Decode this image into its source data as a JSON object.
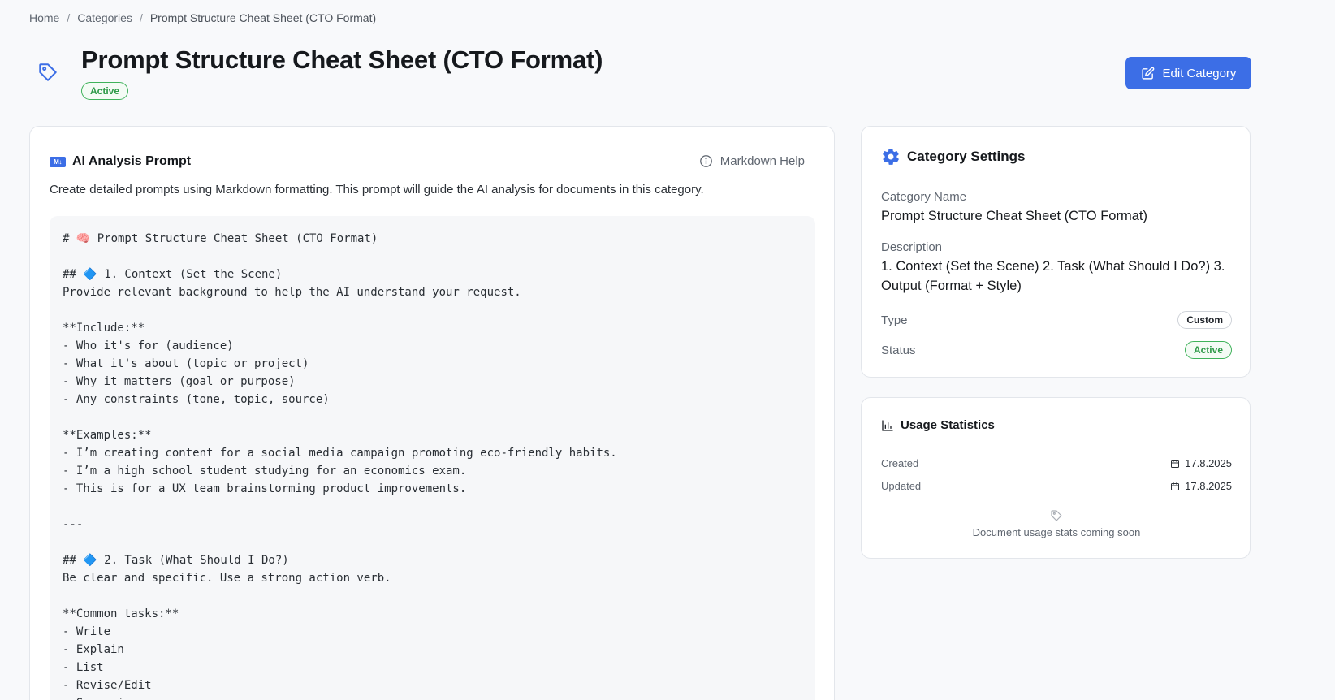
{
  "breadcrumb": {
    "home": "Home",
    "separator": "/",
    "categories": "Categories",
    "current": "Prompt Structure Cheat Sheet (CTO Format)"
  },
  "header": {
    "title": "Prompt Structure Cheat Sheet (CTO Format)",
    "status_badge": "Active",
    "edit_button": "Edit Category",
    "title_icon": "tag-icon"
  },
  "prompt_card": {
    "title": "AI Analysis Prompt",
    "md_icon_text": "M↓",
    "help_label": "Markdown Help",
    "description": "Create detailed prompts using Markdown formatting. This prompt will guide the AI analysis for documents in this category.",
    "lines": [
      "# 🧠 Prompt Structure Cheat Sheet (CTO Format)",
      "",
      "## 🔷 1. Context (Set the Scene)",
      "Provide relevant background to help the AI understand your request.",
      "",
      "**Include:**",
      "- Who it's for (audience)",
      "- What it's about (topic or project)",
      "- Why it matters (goal or purpose)",
      "- Any constraints (tone, topic, source)",
      "",
      "**Examples:**",
      "- I’m creating content for a social media campaign promoting eco-friendly habits.",
      "- I’m a high school student studying for an economics exam.",
      "- This is for a UX team brainstorming product improvements.",
      "",
      "---",
      "",
      "## 🔷 2. Task (What Should I Do?)",
      "Be clear and specific. Use a strong action verb.",
      "",
      "**Common tasks:**",
      "- Write",
      "- Explain",
      "- List",
      "- Revise/Edit",
      "- Summarize"
    ]
  },
  "settings": {
    "title": "Category Settings",
    "name_label": "Category Name",
    "name_value": "Prompt Structure Cheat Sheet (CTO Format)",
    "description_label": "Description",
    "description_value": "1. Context (Set the Scene) 2. Task (What Should I Do?) 3. Output (Format + Style)",
    "type_label": "Type",
    "type_value": "Custom",
    "status_label": "Status",
    "status_value": "Active"
  },
  "stats": {
    "title": "Usage Statistics",
    "created_label": "Created",
    "created_value": "17.8.2025",
    "updated_label": "Updated",
    "updated_value": "17.8.2025",
    "coming_soon": "Document usage stats coming soon"
  },
  "colors": {
    "primary": "#3c6ee6",
    "success": "#3fb25a",
    "background": "#f8f9fb"
  }
}
